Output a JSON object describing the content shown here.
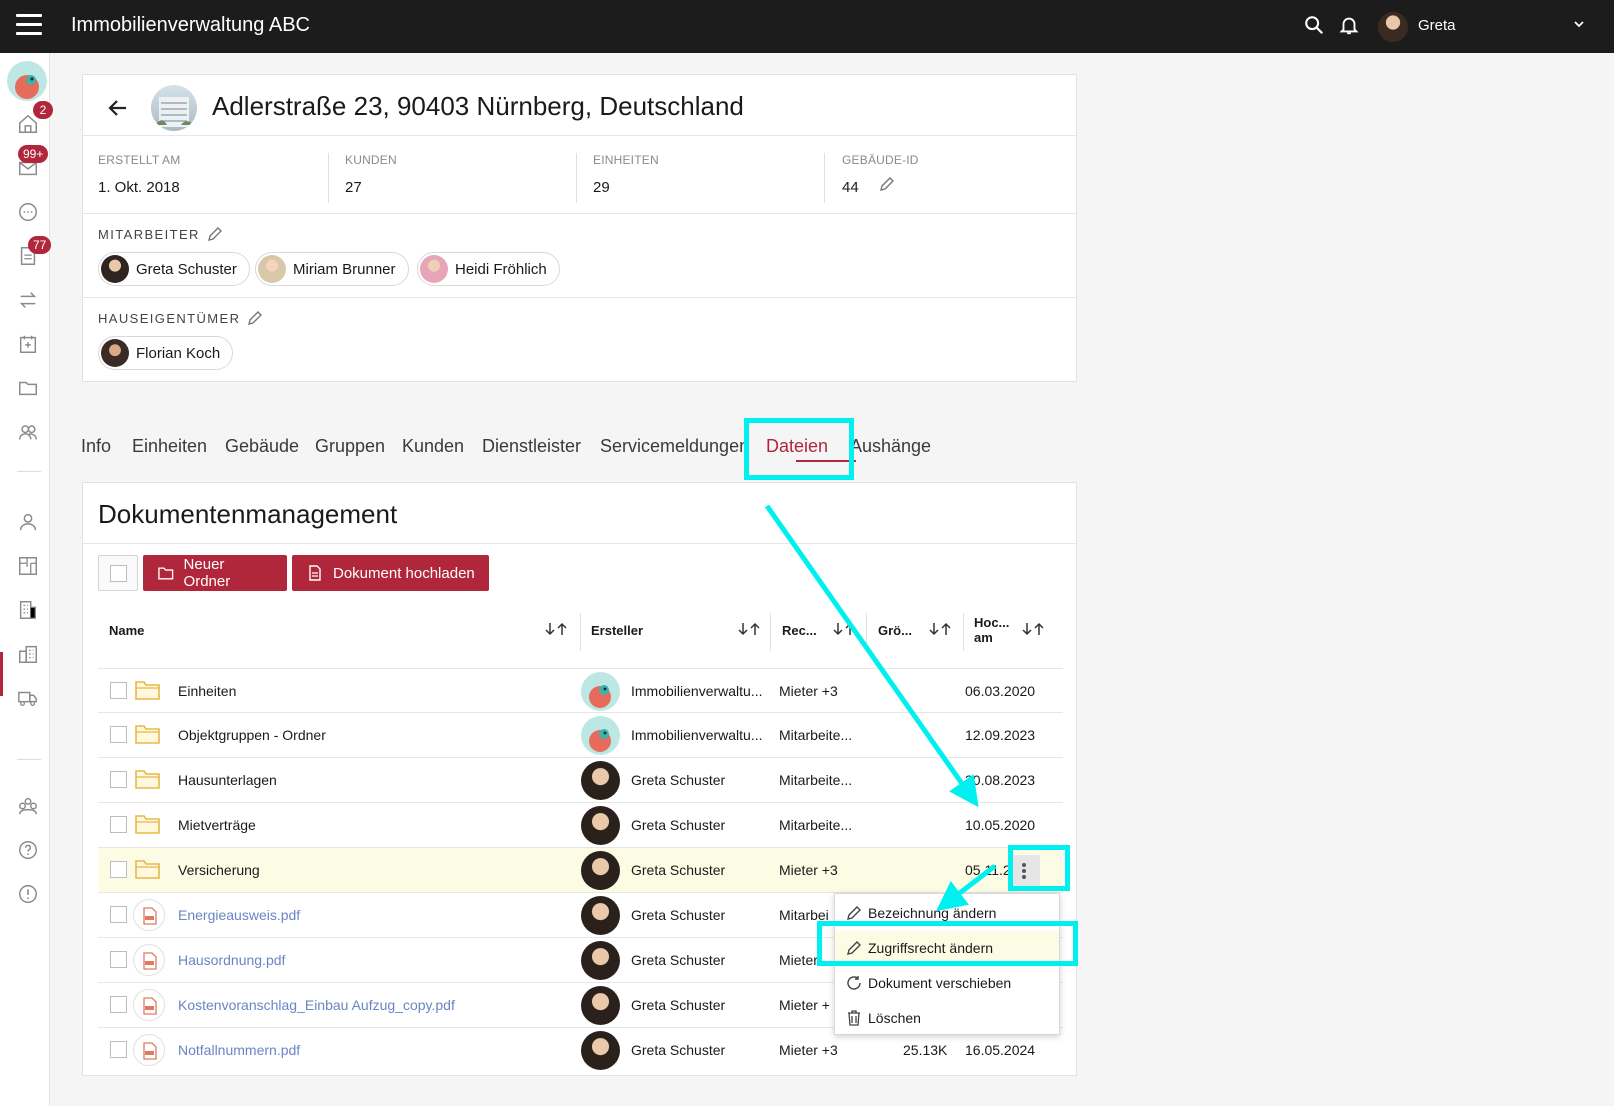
{
  "app": {
    "title": "Immobilienverwaltung ABC",
    "user_name": "Greta"
  },
  "sidebar": {
    "badges": {
      "home": "2",
      "mail": "99+",
      "documents": "77"
    }
  },
  "property": {
    "title": "Adlerstraße 23, 90403 Nürnberg, Deutschland",
    "stats": [
      {
        "label": "ERSTELLT AM",
        "value": "1. Okt. 2018"
      },
      {
        "label": "KUNDEN",
        "value": "27"
      },
      {
        "label": "EINHEITEN",
        "value": "29"
      },
      {
        "label": "GEBÄUDE-ID",
        "value": "44"
      }
    ],
    "employees_label": "MITARBEITER",
    "employees": [
      "Greta Schuster",
      "Miriam Brunner",
      "Heidi Fröhlich"
    ],
    "owners_label": "HAUSEIGENTÜMER",
    "owners": [
      "Florian Koch"
    ]
  },
  "tabs": [
    "Info",
    "Einheiten",
    "Gebäude",
    "Gruppen",
    "Kunden",
    "Dienstleister",
    "Servicemeldungen",
    "Dateien",
    "Aushänge"
  ],
  "active_tab": "Dateien",
  "documents": {
    "title": "Dokumentenmanagement",
    "new_folder_label": "Neuer Ordner",
    "upload_label": "Dokument hochladen",
    "columns": {
      "name": "Name",
      "creator": "Ersteller",
      "rights": "Rec...",
      "size": "Grö...",
      "uploaded_line1": "Hoc...",
      "uploaded_line2": "am"
    },
    "rows": [
      {
        "name": "Einheiten",
        "type": "folder",
        "creator": "Immobilienverwaltu...",
        "rights": "Mieter +3",
        "size": "",
        "date": "06.03.2020"
      },
      {
        "name": "Objektgruppen - Ordner",
        "type": "folder",
        "creator": "Immobilienverwaltu...",
        "rights": "Mitarbeite...",
        "size": "",
        "date": "12.09.2023"
      },
      {
        "name": "Hausunterlagen",
        "type": "folder",
        "creator": "Greta Schuster",
        "rights": "Mitarbeite...",
        "size": "",
        "date": "30.08.2023"
      },
      {
        "name": "Mietverträge",
        "type": "folder",
        "creator": "Greta Schuster",
        "rights": "Mitarbeite...",
        "size": "",
        "date": "10.05.2020"
      },
      {
        "name": "Versicherung",
        "type": "folder",
        "creator": "Greta Schuster",
        "rights": "Mieter +3",
        "size": "",
        "date": "05.11.2"
      },
      {
        "name": "Energieausweis.pdf",
        "type": "pdf",
        "creator": "Greta Schuster",
        "rights": "Mitarbei",
        "size": "",
        "date": ""
      },
      {
        "name": "Hausordnung.pdf",
        "type": "pdf",
        "creator": "Greta Schuster",
        "rights": "Mieter",
        "size": "",
        "date": ""
      },
      {
        "name": "Kostenvoranschlag_Einbau Aufzug_copy.pdf",
        "type": "pdf",
        "creator": "Greta Schuster",
        "rights": "Mieter +",
        "size": "",
        "date": ""
      },
      {
        "name": "Notfallnummern.pdf",
        "type": "pdf",
        "creator": "Greta Schuster",
        "rights": "Mieter +3",
        "size": "25.13K",
        "date": "16.05.2024"
      }
    ]
  },
  "context_menu": {
    "items": [
      {
        "label": "Bezeichnung ändern",
        "icon": "pencil-icon"
      },
      {
        "label": "Zugriffsrecht ändern",
        "icon": "pencil-icon"
      },
      {
        "label": "Dokument verschieben",
        "icon": "move-icon"
      },
      {
        "label": "Löschen",
        "icon": "trash-icon"
      }
    ]
  },
  "colors": {
    "accent": "#b0263b",
    "annotation": "#00f0f0",
    "highlight": "#fcfbe3",
    "link": "#6a84c6"
  }
}
